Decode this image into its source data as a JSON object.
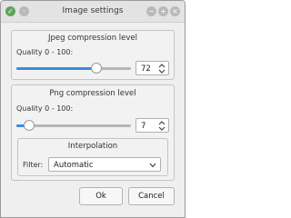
{
  "window": {
    "title": "Image settings"
  },
  "jpeg": {
    "group_title": "Jpeg compression level",
    "quality_label": "Quality 0 - 100:",
    "quality_value": "72",
    "slider_fraction": 0.72
  },
  "png": {
    "group_title": "Png compression level",
    "quality_label": "Quality 0 - 100:",
    "quality_value": "7",
    "slider_fraction": 0.07
  },
  "interpolation": {
    "group_title": "Interpolation",
    "filter_label": "Filter:",
    "filter_value": "Automatic"
  },
  "buttons": {
    "ok_label": "Ok",
    "cancel_label": "Cancel"
  },
  "colors": {
    "accent": "#3a8dde",
    "titlebar_button": "#5ca55a"
  }
}
